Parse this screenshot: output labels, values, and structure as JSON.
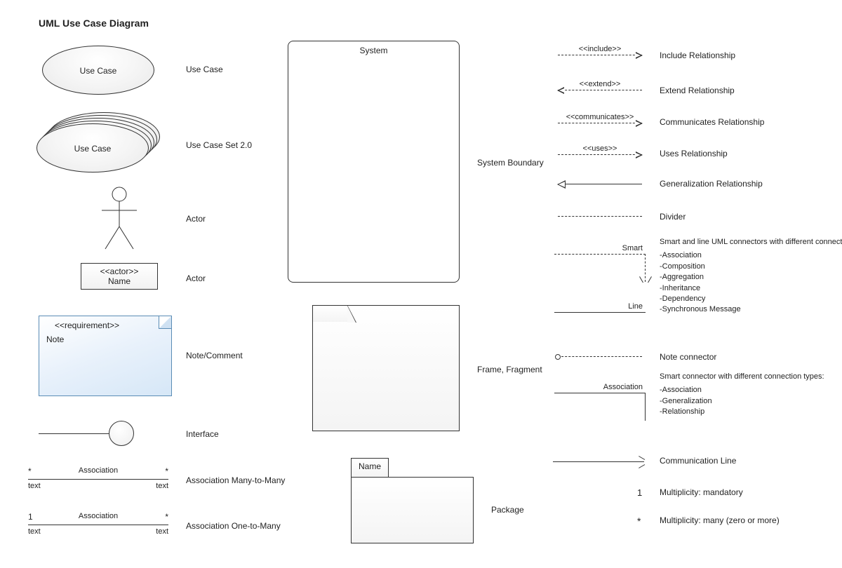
{
  "title": "UML Use Case Diagram",
  "left": {
    "use_case": {
      "shape_text": "Use Case",
      "label": "Use Case"
    },
    "use_case_set": {
      "shape_text": "Use Case",
      "label": "Use Case Set 2.0"
    },
    "actor_stick": {
      "label": "Actor"
    },
    "actor_box": {
      "stereotype": "<<actor>>",
      "name": "Name",
      "label": "Actor"
    },
    "note": {
      "stereotype": "<<requirement>>",
      "text": "Note",
      "label": "Note/Comment"
    },
    "interface": {
      "label": "Interface"
    },
    "assoc_many": {
      "left_m": "*",
      "right_m": "*",
      "mid": "Association",
      "left_b": "text",
      "right_b": "text",
      "label": "Association Many-to-Many"
    },
    "assoc_one": {
      "left_m": "1",
      "right_m": "*",
      "mid": "Association",
      "left_b": "text",
      "right_b": "text",
      "label": "Association One-to-Many"
    }
  },
  "middle": {
    "system": {
      "title": "System",
      "label": "System Boundary"
    },
    "frame": {
      "label": "Frame, Fragment"
    },
    "package": {
      "tab": "Name",
      "label": "Package"
    }
  },
  "right": {
    "include": {
      "text": "<<include>>",
      "label": "Include Relationship"
    },
    "extend": {
      "text": "<<extend>>",
      "label": "Extend Relationship"
    },
    "communicates": {
      "text": "<<communicates>>",
      "label": "Communicates Relationship"
    },
    "uses": {
      "text": "<<uses>>",
      "label": "Uses Relationship"
    },
    "generalization": {
      "label": "Generalization Relationship"
    },
    "divider": {
      "label": "Divider"
    },
    "smart": {
      "mid": "Smart"
    },
    "smart_desc": {
      "desc": "Smart and line UML connectors with different connection types:",
      "items": [
        "-Association",
        "-Composition",
        "-Aggregation",
        "-Inheritance",
        "-Dependency",
        "-Synchronous Message"
      ]
    },
    "line": {
      "mid": "Line"
    },
    "note_conn": {
      "label": "Note connector"
    },
    "association_conn": {
      "mid": "Association"
    },
    "assoc_desc": {
      "desc": "Smart connector with different connection types:",
      "items": [
        "-Association",
        "-Generalization",
        "-Relationship"
      ]
    },
    "comm_line": {
      "label": "Communication Line"
    },
    "mult_mandatory": {
      "symbol": "1",
      "label": "Multiplicity: mandatory"
    },
    "mult_many": {
      "symbol": "*",
      "label": "Multiplicity: many (zero or more)"
    }
  }
}
